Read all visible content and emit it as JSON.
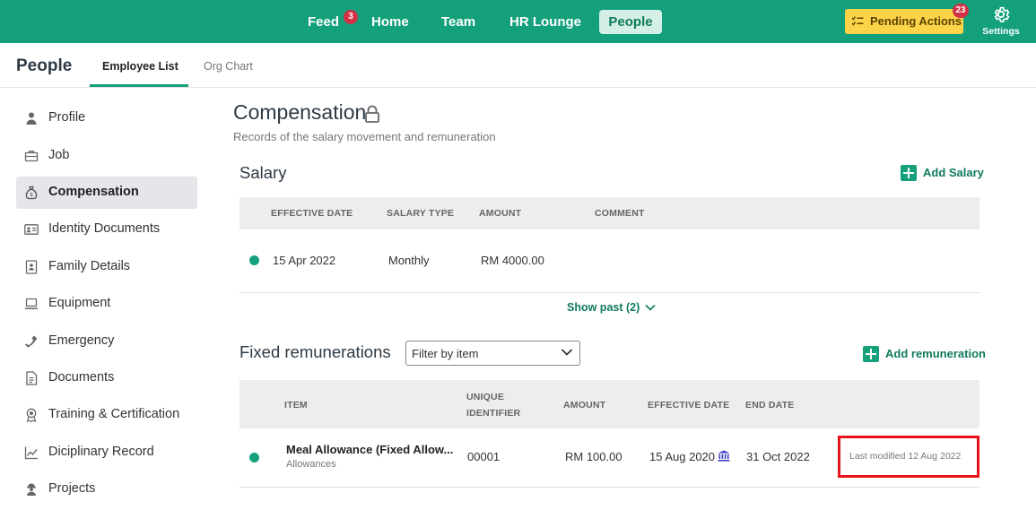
{
  "topbar": {
    "nav": [
      {
        "label": "Feed",
        "badge": "3"
      },
      {
        "label": "Home"
      },
      {
        "label": "Team"
      },
      {
        "label": "HR Lounge"
      },
      {
        "label": "People",
        "active": true
      }
    ],
    "pending_actions": {
      "label": "Pending Actions",
      "badge": "23"
    },
    "settings_label": "Settings",
    "color": "#13a07b"
  },
  "subheader": {
    "title": "People",
    "tabs": [
      {
        "label": "Employee List",
        "active": true
      },
      {
        "label": "Org Chart"
      }
    ]
  },
  "sidebar": {
    "items": [
      {
        "label": "Profile",
        "icon": "person-icon"
      },
      {
        "label": "Job",
        "icon": "briefcase-icon"
      },
      {
        "label": "Compensation",
        "icon": "money-bag-icon",
        "active": true
      },
      {
        "label": "Identity Documents",
        "icon": "id-card-icon"
      },
      {
        "label": "Family Details",
        "icon": "contact-card-icon"
      },
      {
        "label": "Equipment",
        "icon": "laptop-icon"
      },
      {
        "label": "Emergency",
        "icon": "phone-icon"
      },
      {
        "label": "Documents",
        "icon": "document-icon"
      },
      {
        "label": "Training & Certification",
        "icon": "award-icon"
      },
      {
        "label": "Diciplinary Record",
        "icon": "chart-line-icon"
      },
      {
        "label": "Projects",
        "icon": "worker-icon"
      }
    ]
  },
  "main": {
    "title": "Compensation",
    "subtitle": "Records of the salary movement and remuneration",
    "salary": {
      "title": "Salary",
      "add_label": "Add Salary",
      "columns": [
        "EFFECTIVE DATE",
        "SALARY TYPE",
        "AMOUNT",
        "COMMENT"
      ],
      "rows": [
        {
          "effective_date": "15 Apr 2022",
          "salary_type": "Monthly",
          "amount": "RM 4000.00",
          "comment": ""
        }
      ],
      "show_past_label": "Show past (2)"
    },
    "remunerations": {
      "title": "Fixed remunerations",
      "filter_placeholder": "Filter by item",
      "add_label": "Add remuneration",
      "columns": {
        "item": "ITEM",
        "unique_id_line1": "UNIQUE",
        "unique_id_line2": "IDENTIFIER",
        "amount": "AMOUNT",
        "effective_date": "EFFECTIVE DATE",
        "end_date": "END DATE"
      },
      "rows": [
        {
          "item": "Meal Allowance (Fixed Allow...",
          "category": "Allowances",
          "unique_id": "00001",
          "amount": "RM 100.00",
          "effective_date": "15 Aug 2020",
          "end_date": "31 Oct 2022",
          "last_modified": "Last modified 12 Aug 2022"
        }
      ]
    }
  }
}
